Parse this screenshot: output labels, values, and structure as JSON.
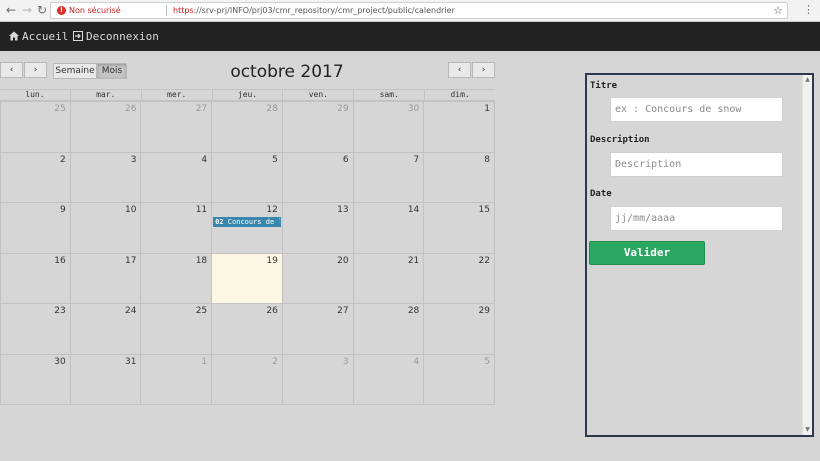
{
  "browser": {
    "security_text": "Non sécurisé",
    "url_scheme": "https",
    "url_rest": "://srv-prj/INFO/prj03/cmr_repository/cmr_project/public/calendrier"
  },
  "navbar": {
    "home_label": "Accueil",
    "logout_label": "Deconnexion"
  },
  "calendar": {
    "title": "octobre 2017",
    "prev_symbol": "‹",
    "next_symbol": "›",
    "view_week": "Semaine",
    "view_month": "Mois",
    "active_view": "Mois",
    "weekdays": [
      "lun.",
      "mar.",
      "mer.",
      "jeu.",
      "ven.",
      "sam.",
      "dim."
    ],
    "weeks": [
      [
        {
          "d": "25",
          "other": true
        },
        {
          "d": "26",
          "other": true
        },
        {
          "d": "27",
          "other": true
        },
        {
          "d": "28",
          "other": true
        },
        {
          "d": "29",
          "other": true
        },
        {
          "d": "30",
          "other": true
        },
        {
          "d": "1"
        }
      ],
      [
        {
          "d": "2"
        },
        {
          "d": "3"
        },
        {
          "d": "4"
        },
        {
          "d": "5"
        },
        {
          "d": "6"
        },
        {
          "d": "7"
        },
        {
          "d": "8"
        }
      ],
      [
        {
          "d": "9"
        },
        {
          "d": "10"
        },
        {
          "d": "11"
        },
        {
          "d": "12",
          "event_time": "02",
          "event_title": "Concours de l"
        },
        {
          "d": "13"
        },
        {
          "d": "14"
        },
        {
          "d": "15"
        }
      ],
      [
        {
          "d": "16"
        },
        {
          "d": "17"
        },
        {
          "d": "18"
        },
        {
          "d": "19",
          "today": true
        },
        {
          "d": "20"
        },
        {
          "d": "21"
        },
        {
          "d": "22"
        }
      ],
      [
        {
          "d": "23"
        },
        {
          "d": "24"
        },
        {
          "d": "25"
        },
        {
          "d": "26"
        },
        {
          "d": "27"
        },
        {
          "d": "28"
        },
        {
          "d": "29"
        }
      ],
      [
        {
          "d": "30"
        },
        {
          "d": "31"
        },
        {
          "d": "1",
          "other": true
        },
        {
          "d": "2",
          "other": true
        },
        {
          "d": "3",
          "other": true
        },
        {
          "d": "4",
          "other": true
        },
        {
          "d": "5",
          "other": true
        }
      ]
    ]
  },
  "form": {
    "title_label": "Titre",
    "title_placeholder": "ex : Concours de snow",
    "description_label": "Description",
    "description_placeholder": "Description",
    "date_label": "Date",
    "date_placeholder": "jj/mm/aaaa",
    "submit_label": "Valider"
  },
  "colors": {
    "navbar_bg": "#222222",
    "event_bg": "#3a87ad",
    "today_bg": "#fcf7e2",
    "submit_bg": "#2aa760",
    "panel_border": "#2b3a4f"
  },
  "icons": {
    "home": "home-icon",
    "logout": "logout-icon"
  }
}
